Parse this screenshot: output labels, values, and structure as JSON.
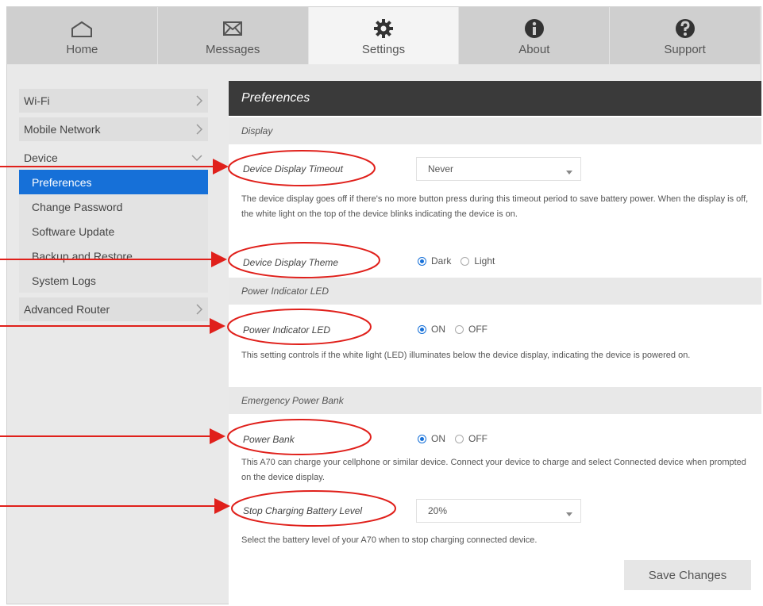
{
  "nav": {
    "tabs": [
      {
        "label": "Home",
        "icon": "home-icon"
      },
      {
        "label": "Messages",
        "icon": "envelope-icon"
      },
      {
        "label": "Settings",
        "icon": "gear-icon"
      },
      {
        "label": "About",
        "icon": "info-icon"
      },
      {
        "label": "Support",
        "icon": "help-icon"
      }
    ],
    "active": "Settings"
  },
  "sidebar": {
    "wifi": "Wi-Fi",
    "mobile_network": "Mobile Network",
    "device": "Device",
    "sub_items": [
      "Preferences",
      "Change Password",
      "Software Update",
      "Backup and Restore",
      "System Logs"
    ],
    "active_sub": "Preferences",
    "advanced_router": "Advanced Router"
  },
  "main": {
    "title": "Preferences",
    "display": {
      "section": "Display",
      "timeout_label": "Device Display Timeout",
      "timeout_value": "Never",
      "timeout_desc": "The device display goes off if there's no more button press during this timeout period to save battery power. When the display is off, the white light on the top of the device blinks indicating the device is on.",
      "theme_label": "Device Display Theme",
      "theme_options": [
        "Dark",
        "Light"
      ],
      "theme_selected": "Dark"
    },
    "led": {
      "section": "Power Indicator LED",
      "label": "Power Indicator LED",
      "options": [
        "ON",
        "OFF"
      ],
      "selected": "ON",
      "desc": "This setting controls if the white light (LED) illuminates below the device display, indicating the device is powered on."
    },
    "power_bank": {
      "section": "Emergency Power Bank",
      "label": "Power Bank",
      "options": [
        "ON",
        "OFF"
      ],
      "selected": "ON",
      "desc": "This A70 can charge your cellphone or similar device. Connect your device to charge and select Connected device when prompted on the device display.",
      "stop_label": "Stop Charging Battery Level",
      "stop_value": "20%",
      "stop_desc": "Select the battery level of your A70 when to stop charging connected device."
    },
    "save_label": "Save Changes"
  },
  "colors": {
    "accent": "#1670d8",
    "header_dark": "#3a3a3a",
    "annotation_red": "#e0201b"
  }
}
